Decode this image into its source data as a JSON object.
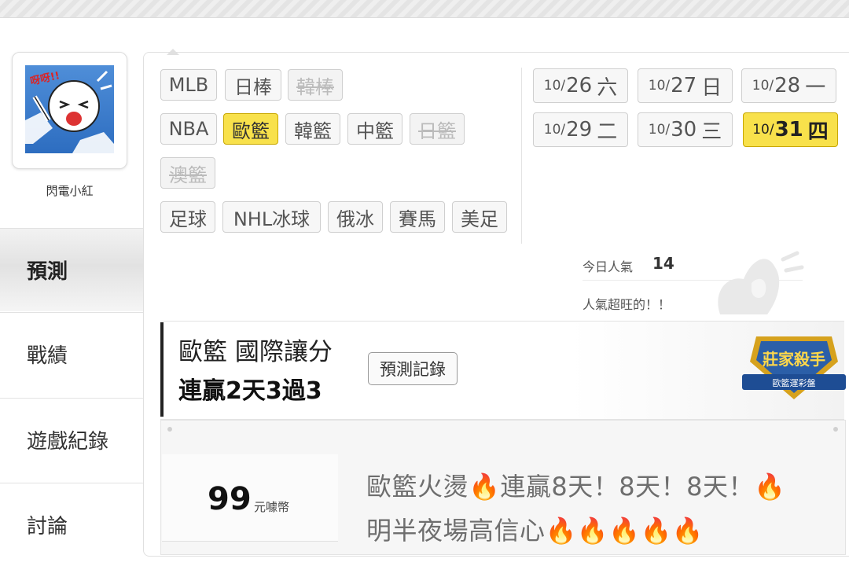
{
  "user": {
    "name": "閃電小紅",
    "avatar_caption": "呀呀!!"
  },
  "sidebar": {
    "items": [
      {
        "label": "預測",
        "active": true
      },
      {
        "label": "戰績",
        "active": false
      },
      {
        "label": "遊戲紀錄",
        "active": false
      },
      {
        "label": "討論",
        "active": false
      }
    ]
  },
  "sports": [
    {
      "label": "MLB",
      "state": "normal"
    },
    {
      "label": "日棒",
      "state": "normal"
    },
    {
      "label": "韓棒",
      "state": "disabled"
    },
    {
      "label": "NBA",
      "state": "normal"
    },
    {
      "label": "歐籃",
      "state": "selected"
    },
    {
      "label": "韓籃",
      "state": "normal"
    },
    {
      "label": "中籃",
      "state": "normal"
    },
    {
      "label": "日籃",
      "state": "disabled"
    },
    {
      "label": "澳籃",
      "state": "disabled"
    },
    {
      "label": "足球",
      "state": "normal"
    },
    {
      "label": "NHL冰球",
      "state": "normal"
    },
    {
      "label": "俄冰",
      "state": "normal"
    },
    {
      "label": "賽馬",
      "state": "normal"
    },
    {
      "label": "美足",
      "state": "normal"
    }
  ],
  "dates": [
    {
      "mon": "10/",
      "day": "26",
      "wk": "六",
      "selected": false
    },
    {
      "mon": "10/",
      "day": "27",
      "wk": "日",
      "selected": false
    },
    {
      "mon": "10/",
      "day": "28",
      "wk": "一",
      "selected": false
    },
    {
      "mon": "10/",
      "day": "29",
      "wk": "二",
      "selected": false
    },
    {
      "mon": "10/",
      "day": "30",
      "wk": "三",
      "selected": false
    },
    {
      "mon": "10/",
      "day": "31",
      "wk": "四",
      "selected": true
    }
  ],
  "popularity": {
    "label": "今日人氣",
    "count": "14",
    "note": "人氣超旺的！！"
  },
  "prediction": {
    "title": "歐籃 國際讓分",
    "streak": "連贏2天3過3",
    "record_button": "預測記錄",
    "badge_title": "莊家殺手",
    "badge_sub": "歐籃運彩盤"
  },
  "offer": {
    "price": "99",
    "unit": "元噱幣",
    "line1": "歐籃火燙",
    "line1b": "連贏8天！8天！8天！",
    "line2": "明半夜場高信心"
  },
  "colors": {
    "selected": "#f8e14b",
    "fire": "#ff6a00",
    "accent_bar": "#222222"
  },
  "icons": {
    "fire": "fire-icon",
    "badge": "trophy-badge-icon",
    "mascot": "mascot-watermark-icon"
  }
}
